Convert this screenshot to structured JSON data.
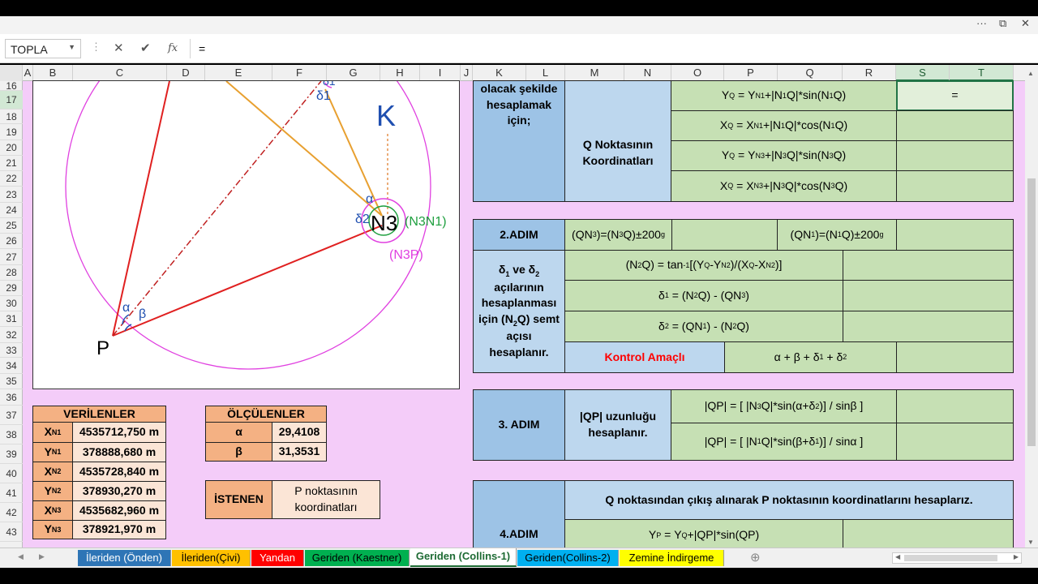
{
  "window": {
    "more": "···",
    "restore": "⧉",
    "close": "✕"
  },
  "formula_bar": {
    "name_box": "TOPLA",
    "cancel": "✕",
    "enter": "✔",
    "fx": "fx",
    "formula": "="
  },
  "columns": [
    "A",
    "B",
    "C",
    "D",
    "E",
    "F",
    "G",
    "H",
    "I",
    "J",
    "K",
    "L",
    "M",
    "N",
    "O",
    "P",
    "Q",
    "R",
    "S",
    "T"
  ],
  "rows": [
    "16",
    "17",
    "18",
    "19",
    "20",
    "21",
    "22",
    "23",
    "24",
    "25",
    "26",
    "27",
    "28",
    "29",
    "30",
    "31",
    "32",
    "33",
    "34",
    "35",
    "36",
    "37",
    "38",
    "39",
    "40",
    "41",
    "42",
    "43"
  ],
  "diagram": {
    "K": "K",
    "N3": "N3",
    "N3N1": "(N3N1)",
    "N3P": "(N3P)",
    "P": "P",
    "alpha": "α",
    "beta": "β",
    "delta1": "δ1",
    "delta2": "δ2",
    "alpha2": "α",
    "delta2b": "δ2"
  },
  "verilenler": {
    "title": "VERİLENLER",
    "rows": [
      {
        "label": "X",
        "sub": "N1",
        "value": "4535712,750 m"
      },
      {
        "label": "Y",
        "sub": "N1",
        "value": "378888,680 m"
      },
      {
        "label": "X",
        "sub": "N2",
        "value": "4535728,840 m"
      },
      {
        "label": "Y",
        "sub": "N2",
        "value": "378930,270 m"
      },
      {
        "label": "X",
        "sub": "N3",
        "value": "4535682,960 m"
      },
      {
        "label": "Y",
        "sub": "N3",
        "value": "378921,970 m"
      }
    ]
  },
  "olculenler": {
    "title": "ÖLÇÜLENLER",
    "rows": [
      {
        "label": "α",
        "value": "29,4108"
      },
      {
        "label": "β",
        "value": "31,3531"
      }
    ]
  },
  "istenen": {
    "label": "İSTENEN",
    "value": "P noktasının koordinatları"
  },
  "block1": {
    "left_text": "olacak şekilde hesaplamak için;",
    "mid_text": "Q Noktasının Koordinatları",
    "active_cell": "=",
    "formulas": [
      "Y_Q = Y_N1+|N1Q|*sin(N1Q)",
      "X_Q = X_N1+|N1Q|*cos(N1Q)",
      "Y_Q = Y_N3+|N3Q|*sin(N3Q)",
      "X_Q = X_N3+|N3Q|*cos(N3Q)"
    ]
  },
  "block2": {
    "step": "2.ADIM",
    "f1": "(QN3)=(N3Q)±200g",
    "f2": "(QN1)=(N1Q)±200g",
    "left_text": "δ1 ve δ2 açılarının hesaplanması için (N2Q) semt açısı hesaplanır.",
    "f3": "(N2Q) = tan-1[(YQ-YN2)/(XQ-XN2)]",
    "f4": "δ1 = (N2Q) - (QN3)",
    "f5": "δ2 = (QN1) - (N2Q)",
    "control": "Kontrol Amaçlı",
    "f6": "α + β + δ1 + δ2"
  },
  "block3": {
    "step": "3. ADIM",
    "mid": "|QP| uzunluğu hesaplanır.",
    "f1": "|QP| = [ |N3Q|*sin(α+δ2)] / sinβ ]",
    "f2": "|QP| = [ |N1Q|*sin(β+δ1)] / sinα ]"
  },
  "block4": {
    "step": "4.ADIM",
    "title": "Q noktasından çıkış alınarak P noktasının koordinatlarını hesaplarız.",
    "f1": "YP = YQ+|QP|*sin(QP)"
  },
  "tabs": [
    {
      "label": "İleriden (Önden)",
      "color": "#2e75b6",
      "text_color": "#ffffff"
    },
    {
      "label": "İleriden(Çivi)",
      "color": "#ffc000",
      "text_color": "#000000"
    },
    {
      "label": "Yandan",
      "color": "#ff0000",
      "text_color": "#ffffff"
    },
    {
      "label": "Geriden (Kaestner)",
      "color": "#00b050",
      "text_color": "#000000"
    },
    {
      "label": "Geriden (Collins-1)",
      "color": "#ffffff",
      "text_color": "#1e6b34"
    },
    {
      "label": "Geriden(Collins-2)",
      "color": "#00b0f0",
      "text_color": "#000000"
    },
    {
      "label": "Zemine İndirgeme",
      "color": "#ffff00",
      "text_color": "#000000"
    }
  ]
}
